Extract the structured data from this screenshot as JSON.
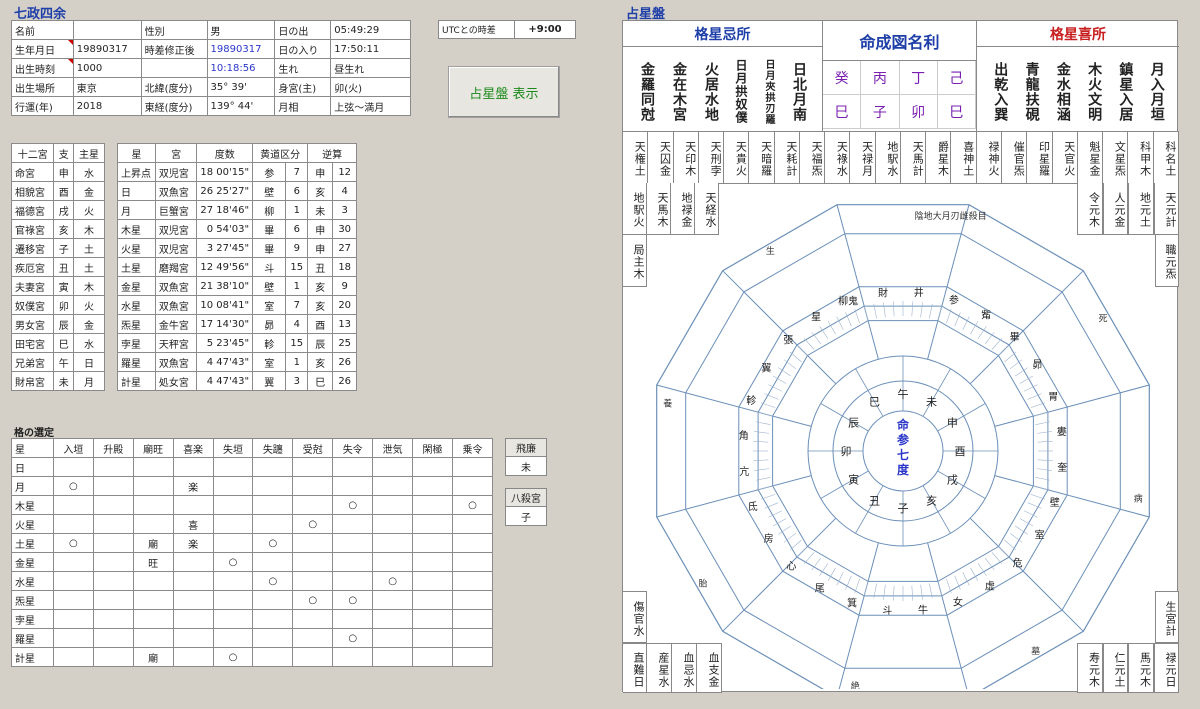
{
  "app_title": "七政四余",
  "basic": {
    "rows": [
      [
        "名前",
        "",
        "性別",
        "男",
        "日の出",
        "05:49:29"
      ],
      [
        "生年月日",
        "19890317",
        "時差修正後",
        "19890317",
        "日の入り",
        "17:50:11"
      ],
      [
        "出生時刻",
        "1000",
        "",
        "10:18:56",
        "生れ",
        "昼生れ"
      ],
      [
        "出生場所",
        "東京",
        "北緯(度分)",
        "35° 39'",
        "身宮(主)",
        "卯(火)"
      ],
      [
        "行運(年)",
        "2018",
        "東経(度分)",
        "139° 44'",
        "月相",
        "上弦～満月"
      ]
    ]
  },
  "utc": {
    "label": "UTCとの時差",
    "value": "+9:00"
  },
  "show_button": "占星盤 表示",
  "palace_table": {
    "headers": [
      "十二宮",
      "支",
      "主星"
    ],
    "rows": [
      [
        "命宮",
        "申",
        "水"
      ],
      [
        "相貌宮",
        "酉",
        "金"
      ],
      [
        "福德宮",
        "戌",
        "火"
      ],
      [
        "官祿宮",
        "亥",
        "木"
      ],
      [
        "遷移宮",
        "子",
        "土"
      ],
      [
        "疾厄宮",
        "丑",
        "土"
      ],
      [
        "夫妻宮",
        "寅",
        "木"
      ],
      [
        "奴僕宮",
        "卯",
        "火"
      ],
      [
        "男女宮",
        "辰",
        "金"
      ],
      [
        "田宅宮",
        "巳",
        "水"
      ],
      [
        "兄弟宮",
        "午",
        "日"
      ],
      [
        "財帛宮",
        "未",
        "月"
      ]
    ]
  },
  "star_table": {
    "headers": [
      "星",
      "宮",
      "度数",
      "黄道区分",
      "",
      "逆算",
      ""
    ],
    "rows": [
      [
        "上昇点",
        "双児宮",
        "18 00'15\"",
        "参",
        "7",
        "申",
        "12"
      ],
      [
        "日",
        "双魚宮",
        "26 25'27\"",
        "壁",
        "6",
        "亥",
        "4"
      ],
      [
        "月",
        "巨蟹宮",
        "27 18'46\"",
        "柳",
        "1",
        "未",
        "3"
      ],
      [
        "木星",
        "双児宮",
        "0 54'03\"",
        "畢",
        "6",
        "申",
        "30"
      ],
      [
        "火星",
        "双児宮",
        "3 27'45\"",
        "畢",
        "9",
        "申",
        "27"
      ],
      [
        "土星",
        "磨羯宮",
        "12 49'56\"",
        "斗",
        "15",
        "丑",
        "18"
      ],
      [
        "金星",
        "双魚宮",
        "21 38'10\"",
        "壁",
        "1",
        "亥",
        "9"
      ],
      [
        "水星",
        "双魚宮",
        "10 08'41\"",
        "室",
        "7",
        "亥",
        "20"
      ],
      [
        "炁星",
        "金牛宮",
        "17 14'30\"",
        "昴",
        "4",
        "酉",
        "13"
      ],
      [
        "孛星",
        "天秤宮",
        "5 23'45\"",
        "軫",
        "15",
        "辰",
        "25"
      ],
      [
        "羅星",
        "双魚宮",
        "4 47'43\"",
        "室",
        "1",
        "亥",
        "26"
      ],
      [
        "計星",
        "処女宮",
        "4 47'43\"",
        "翼",
        "3",
        "巳",
        "26"
      ]
    ]
  },
  "kaku": {
    "title": "格の選定",
    "headers": [
      "星",
      "入垣",
      "升殿",
      "廟旺",
      "喜楽",
      "失垣",
      "失躔",
      "受尅",
      "失令",
      "泄気",
      "閑極",
      "乗令"
    ],
    "rows": [
      [
        "日",
        "",
        "",
        "",
        "",
        "",
        "",
        "",
        "",
        "",
        "",
        ""
      ],
      [
        "月",
        "○",
        "",
        "",
        "楽",
        "",
        "",
        "",
        "",
        "",
        "",
        ""
      ],
      [
        "木星",
        "",
        "",
        "",
        "",
        "",
        "",
        "",
        "○",
        "",
        "",
        "○"
      ],
      [
        "火星",
        "",
        "",
        "",
        "喜",
        "",
        "",
        "○",
        "",
        "",
        "",
        ""
      ],
      [
        "土星",
        "○",
        "",
        "廟",
        "楽",
        "",
        "○",
        "",
        "",
        "",
        "",
        ""
      ],
      [
        "金星",
        "",
        "",
        "旺",
        "",
        "○",
        "",
        "",
        "",
        "",
        "",
        ""
      ],
      [
        "水星",
        "",
        "",
        "",
        "",
        "",
        "○",
        "",
        "",
        "○",
        "",
        ""
      ],
      [
        "炁星",
        "",
        "",
        "",
        "",
        "",
        "",
        "○",
        "○",
        "",
        "",
        ""
      ],
      [
        "孛星",
        "",
        "",
        "",
        "",
        "",
        "",
        "",
        "",
        "",
        "",
        ""
      ],
      [
        "羅星",
        "",
        "",
        "",
        "",
        "",
        "",
        "",
        "○",
        "",
        "",
        ""
      ],
      [
        "計星",
        "",
        "",
        "廟",
        "",
        "○",
        "",
        "",
        "",
        "",
        "",
        ""
      ]
    ],
    "hirentou": {
      "label": "飛廉",
      "value": "未"
    },
    "hassatsu": {
      "label": "八殺宮",
      "value": "子"
    }
  },
  "chart": {
    "title": "占星盤",
    "left_header": "格星忌所",
    "center_header": "命成図名利",
    "right_header": "格星喜所",
    "left_cols": [
      "金羅同尅",
      "金在木宮",
      "火居水地",
      "日月拱奴僕",
      "日月夾拱刃羅",
      "日北月南"
    ],
    "right_cols": [
      "出乾入巽",
      "青龍扶硯",
      "金水相涵",
      "木火文明",
      "鎮星入居",
      "月入月垣"
    ],
    "center_top": [
      "癸",
      "丙",
      "丁",
      "己"
    ],
    "center_bottom": [
      "巳",
      "子",
      "卯",
      "巳"
    ],
    "top_row": [
      "天権土",
      "天囚金",
      "天印木",
      "天刑孛",
      "天貴火",
      "天暗羅",
      "天耗計",
      "天福炁",
      "天祿水",
      "天禄月",
      "地駅水",
      "天馬計",
      "爵星木",
      "喜神土",
      "禄神火",
      "催官炁",
      "印星羅",
      "天官火",
      "魁星金",
      "文星炁",
      "科甲木",
      "科名土"
    ],
    "left_side": [
      "地駅火",
      "天馬木",
      "地禄金",
      "天経水",
      "局主木"
    ],
    "right_side": [
      "令元木",
      "人元金",
      "地元土",
      "天元計",
      "職元炁"
    ],
    "bottom_left": [
      "傷官水",
      "直難日",
      "産星水",
      "血忌水",
      "血支金"
    ],
    "bottom_right": [
      "生宮計",
      "寿元木",
      "仁元土",
      "馬元木",
      "禄元日"
    ],
    "center_text": "命参七度",
    "inner_ring": [
      "午",
      "未",
      "申",
      "酉",
      "戌",
      "亥",
      "子",
      "丑",
      "寅",
      "卯",
      "辰",
      "巳"
    ],
    "mid_labels": [
      "柳鬼",
      "財",
      "井",
      "参",
      "觜",
      "畢",
      "昴",
      "胃",
      "婁",
      "奎",
      "壁",
      "室",
      "危",
      "虚",
      "女",
      "牛",
      "斗",
      "箕",
      "尾",
      "心",
      "房",
      "氐",
      "亢",
      "角",
      "軫",
      "翼",
      "張",
      "星"
    ],
    "outer_notes": [
      "陰地大月刃雌殺目",
      "死",
      "病",
      "墓",
      "絶",
      "胎",
      "養",
      "生"
    ]
  }
}
